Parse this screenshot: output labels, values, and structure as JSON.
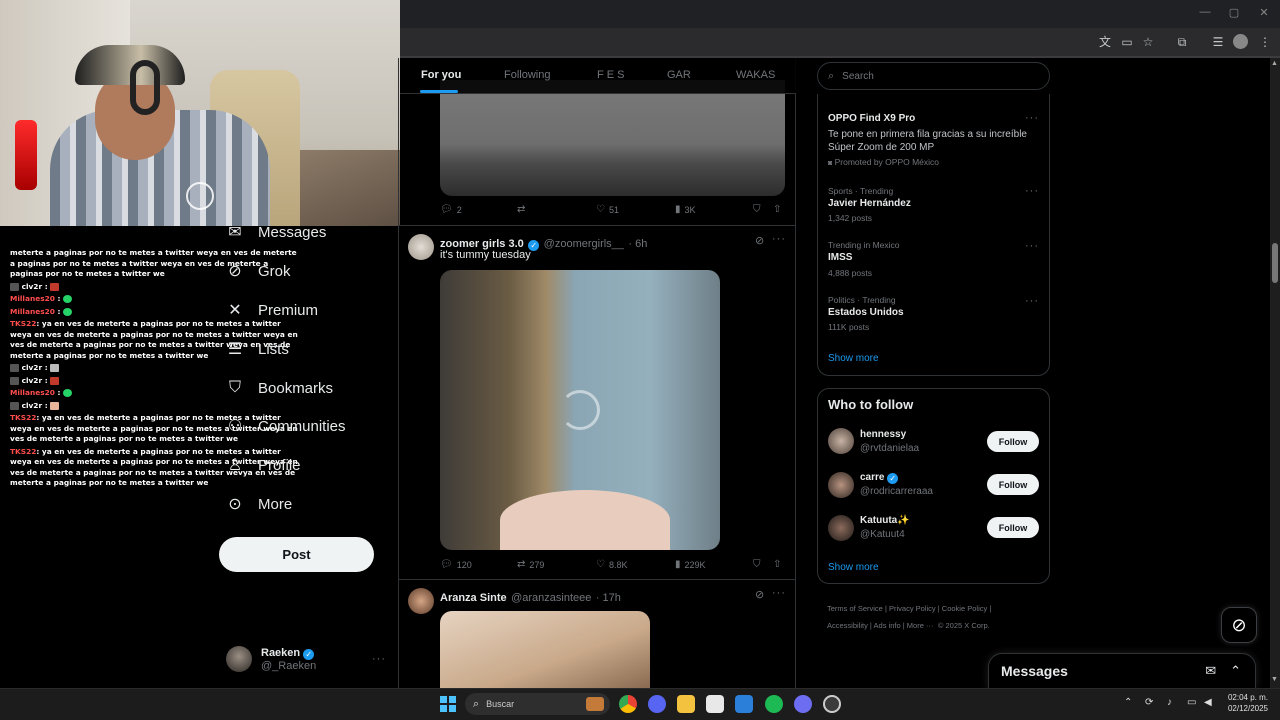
{
  "feed": {
    "tabs": [
      "For you",
      "Following",
      "F E S",
      "GAR",
      "WAKAS"
    ],
    "active_tab": "For you",
    "tweets": [
      {
        "actions": {
          "replies": "2",
          "reposts": "",
          "likes": "51",
          "views": "3K"
        }
      },
      {
        "name": "zoomer girls 3.0",
        "handle": "@zoomergirls__",
        "time": "· 6h",
        "text": "it's tummy tuesday",
        "actions": {
          "replies": "120",
          "reposts": "279",
          "likes": "8.8K",
          "views": "229K"
        }
      },
      {
        "name": "Aranza Sinte",
        "handle": "@aranzasinteee",
        "time": "· 17h"
      }
    ]
  },
  "nav": {
    "items": [
      {
        "label": "Messages",
        "icon": "mail-icon"
      },
      {
        "label": "Grok",
        "icon": "grok-icon"
      },
      {
        "label": "Premium",
        "icon": "x-logo-icon"
      },
      {
        "label": "Lists",
        "icon": "list-icon"
      },
      {
        "label": "Bookmarks",
        "icon": "bookmark-icon"
      },
      {
        "label": "Communities",
        "icon": "communities-icon"
      },
      {
        "label": "Profile",
        "icon": "profile-icon"
      },
      {
        "label": "More",
        "icon": "more-icon"
      }
    ],
    "post_label": "Post"
  },
  "account": {
    "name": "Raeken",
    "handle": "@_Raeken"
  },
  "search": {
    "placeholder": "Search"
  },
  "trends": [
    {
      "title": "OPPO Find X9 Pro",
      "desc": "Te pone en primera fila gracias a su increíble Súper Zoom de 200 MP",
      "promoted": "Promoted by OPPO México"
    },
    {
      "meta": "Sports · Trending",
      "title": "Javier Hernández",
      "count": "1,342 posts"
    },
    {
      "meta": "Trending in Mexico",
      "title": "IMSS",
      "count": "4,888 posts"
    },
    {
      "meta": "Politics · Trending",
      "title": "Estados Unidos",
      "count": "111K posts"
    }
  ],
  "trends_show_more": "Show more",
  "who_to_follow": {
    "title": "Who to follow",
    "follow_label": "Follow",
    "show_more": "Show more",
    "users": [
      {
        "name": "hennessy",
        "handle": "@rvtdanielaa",
        "verified": false
      },
      {
        "name": "carre",
        "handle": "@rodricarreraaa",
        "verified": true
      },
      {
        "name": "Katuuta✨",
        "handle": "@Katuut4",
        "verified": false
      }
    ]
  },
  "footer": {
    "links": [
      "Terms of Service",
      "Privacy Policy",
      "Cookie Policy",
      "Accessibility",
      "Ads info",
      "More ···",
      "© 2025 X Corp."
    ]
  },
  "messages_drawer": {
    "title": "Messages"
  },
  "chat": {
    "lines": [
      {
        "user": "",
        "text": "meterte a paginas por no te metes a twitter weya en ves de meterte a paginas por no te metes a twitter weya en ves de meterte a paginas por no te metes a twitter we"
      },
      {
        "user": "clv2r",
        "text": ":",
        "emote": "emote-red"
      },
      {
        "user": "Millanes20",
        "text": ":",
        "emote": "emote-green"
      },
      {
        "user": "Millanes20",
        "text": ":",
        "emote": "emote-green"
      },
      {
        "user": "TKS22",
        "text": ": ya en ves de meterte a paginas por no te metes a twitter weya en ves de meterte a paginas por no te metes a twitter weya en ves de meterte a paginas por no te metes a twitter weya en ves de meterte a paginas por no te metes a twitter we"
      },
      {
        "user": "clv2r",
        "text": ":",
        "emote": "emote-figure"
      },
      {
        "user": "clv2r",
        "text": ":",
        "emote": "emote-red"
      },
      {
        "user": "Millanes20",
        "text": ":",
        "emote": "emote-green"
      },
      {
        "user": "clv2r",
        "text": ":",
        "emote": "emote-hand"
      },
      {
        "user": "TKS22",
        "text": ": ya en ves de meterte a paginas por no te metes a twitter weya en ves de meterte a paginas por no te metes a twitter weya en ves de meterte a paginas por no te metes a twitter we"
      },
      {
        "user": "TKS22",
        "text": ": ya en ves de meterte a paginas por no te metes a twitter weya en ves de meterte a paginas por no te metes a twitter weya en ves de meterte a paginas por no te metes a twitter wevya en ves de meterte a paginas por no te metes a twitter we"
      }
    ]
  },
  "taskbar": {
    "search_placeholder": "Buscar",
    "time": "02:04 p. m.",
    "date": "02/12/2025"
  },
  "colors": {
    "accent": "#1d9bf0",
    "background": "#000000",
    "border": "#2f3336",
    "muted": "#71767b"
  }
}
